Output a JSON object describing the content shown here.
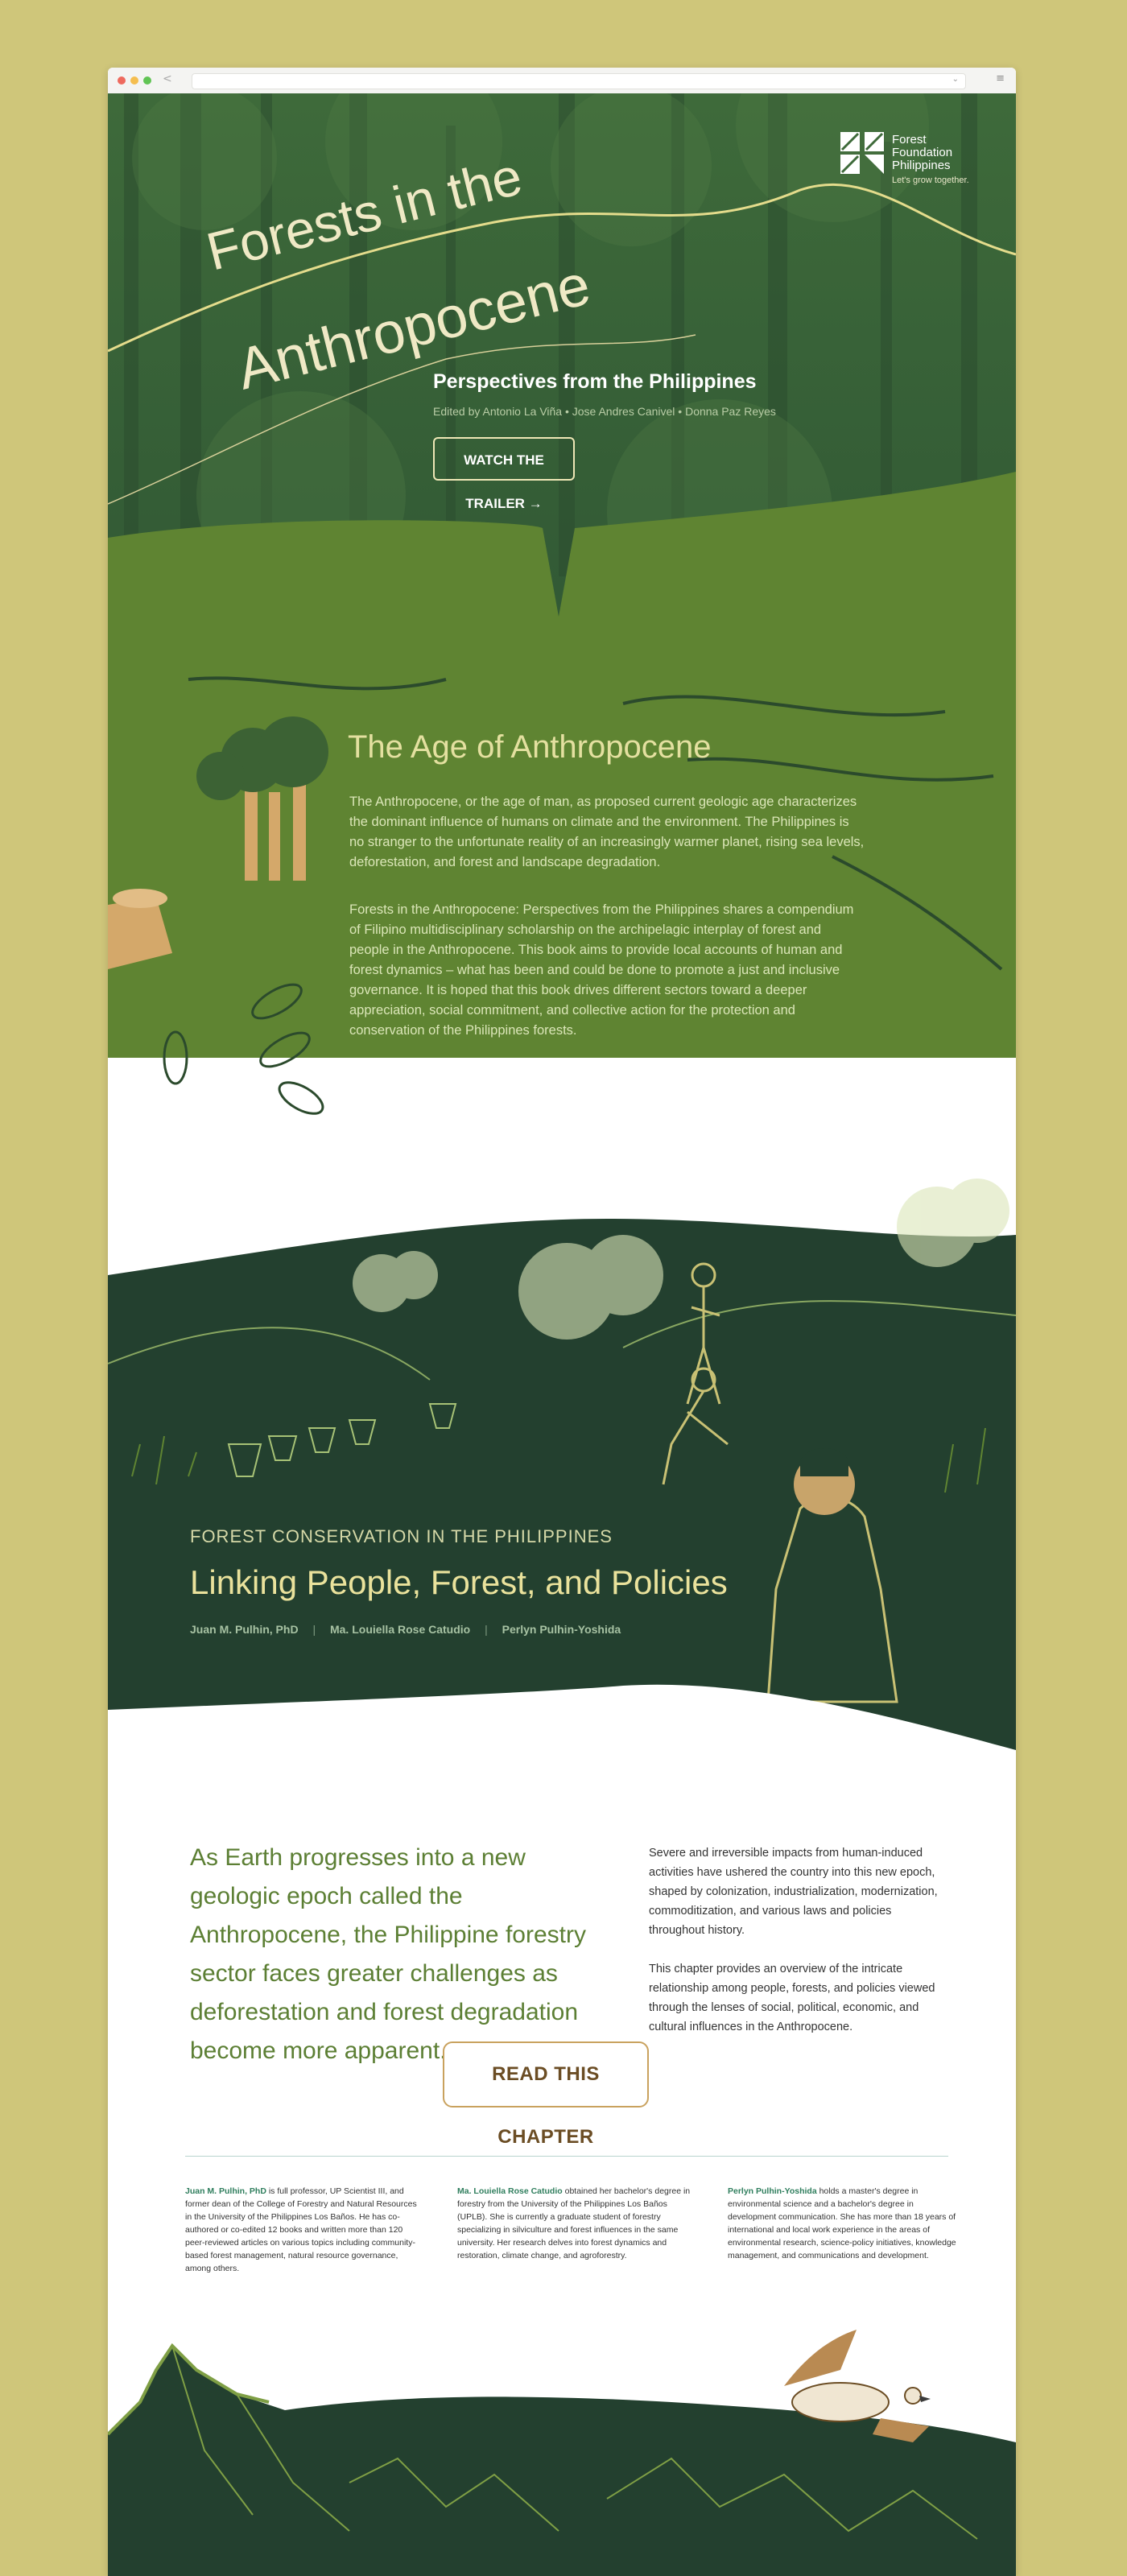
{
  "browser": {
    "back_glyph": "<",
    "menu_glyph": "≡",
    "url_chevron": "⌄"
  },
  "brand": {
    "name_line1": "Forest",
    "name_line2": "Foundation",
    "name_line3": "Philippines",
    "tagline": "Let's grow together."
  },
  "hero": {
    "title_line1": "Forests in the",
    "title_line2": "Anthropocene",
    "subtitle": "Perspectives from the Philippines",
    "editors": "Edited by Antonio La Viña • Jose Andres Canivel • Donna Paz Reyes",
    "trailer_button": "WATCH THE TRAILER →"
  },
  "age": {
    "heading": "The Age of Anthropocene",
    "paragraph1": "The Anthropocene, or the age of man, as proposed current geologic age characterizes the dominant influence of humans on climate and the environment. The Philippines is no stranger to the unfortunate reality of an increasingly warmer planet, rising sea levels, deforestation, and forest and landscape degradation.",
    "paragraph2": "Forests in the Anthropocene: Perspectives from the Philippines shares a compendium of Filipino multidisciplinary scholarship on the archipelagic interplay of forest and people in the Anthropocene. This book aims to provide local accounts of human and forest dynamics – what has been and could be done to promote a just and inclusive governance. It is hoped that this book drives different sectors toward a deeper appreciation, social commitment, and collective action for the protection and conservation of the Philippines forests."
  },
  "chapter": {
    "eyebrow": "FOREST CONSERVATION  IN THE PHILIPPINES",
    "title": "Linking People, Forest, and Policies",
    "authors": [
      "Juan M. Pulhin, PhD",
      "Ma. Louiella Rose Catudio",
      "Perlyn Pulhin-Yoshida"
    ],
    "separator": "|",
    "lead": "As Earth progresses into a new geologic epoch called the Anthropocene, the Philippine forestry sector faces greater challenges as deforestation and forest degradation become more apparent.",
    "side_p1": "Severe and irreversible impacts from human-induced activities have ushered the country into this new epoch, shaped by colonization, industrialization, modernization, commoditization, and various laws and policies throughout history.",
    "side_p2": "This chapter provides an overview of the intricate relationship among people, forests, and policies viewed through the lenses of social, political, economic, and cultural influences in the Anthropocene.",
    "read_button": "READ THIS CHAPTER"
  },
  "bios": [
    {
      "name": "Juan M. Pulhin, PhD",
      "text": " is full professor, UP Scientist III, and former dean of the College of Forestry and Natural Resources in the University of the Philippines Los Baños. He has co-authored or co-edited 12 books and written more than 120 peer-reviewed articles on various topics including community-based forest management, natural resource governance, among others."
    },
    {
      "name": "Ma. Louiella Rose Catudio",
      "text": " obtained her bachelor's degree in forestry from the University of the Philippines Los Baños (UPLB). She is currently a graduate student of forestry specializing in silviculture and forest influences in the same university. Her research delves into forest dynamics and restoration, climate change, and agroforestry."
    },
    {
      "name": "Perlyn Pulhin-Yoshida",
      "text": " holds a master's degree in environmental science and a bachelor's degree in development communication. She has more than 18 years of international and local work experience in the areas of environmental research, science-policy initiatives, knowledge management, and communications and development."
    }
  ],
  "colors": {
    "page_bg": "#cfc67a",
    "forest_dark": "#23402f",
    "forest_mid": "#5f8432",
    "accent_cream": "#eae29c",
    "button_gold": "#c9a25e"
  }
}
